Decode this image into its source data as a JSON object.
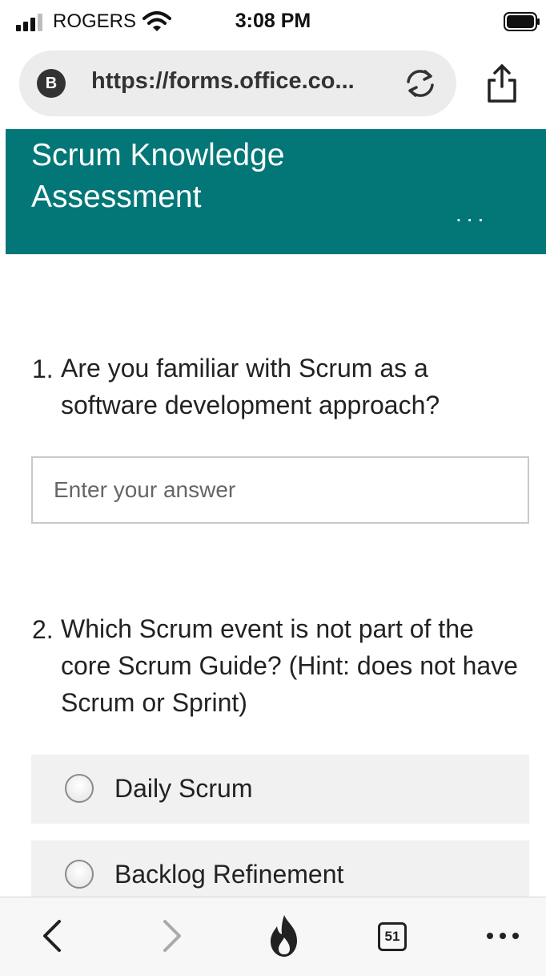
{
  "status_bar": {
    "carrier": "ROGERS",
    "time": "3:08 PM"
  },
  "browser": {
    "site_badge": "B",
    "url": "https://forms.office.co...",
    "icons": [
      "reload-icon",
      "share-icon"
    ]
  },
  "banner": {
    "title": "Scrum Knowledge Assessment",
    "more_label": "..."
  },
  "questions": [
    {
      "number": "1.",
      "text": "Are you familiar with Scrum as a software development approach?",
      "placeholder": "Enter your answer",
      "value": ""
    },
    {
      "number": "2.",
      "text": "Which Scrum event is not part of the core Scrum Guide? (Hint: does not have Scrum or Sprint)",
      "options": [
        "Daily Scrum",
        "Backlog Refinement"
      ]
    }
  ],
  "toolbar": {
    "tab_count": "51",
    "icons": [
      "back-icon",
      "forward-icon",
      "fire-icon",
      "tabs-icon",
      "more-icon"
    ]
  },
  "colors": {
    "banner": "#037777",
    "option_bg": "#f1f1f1",
    "toolbar_bg": "#f7f7f7"
  }
}
